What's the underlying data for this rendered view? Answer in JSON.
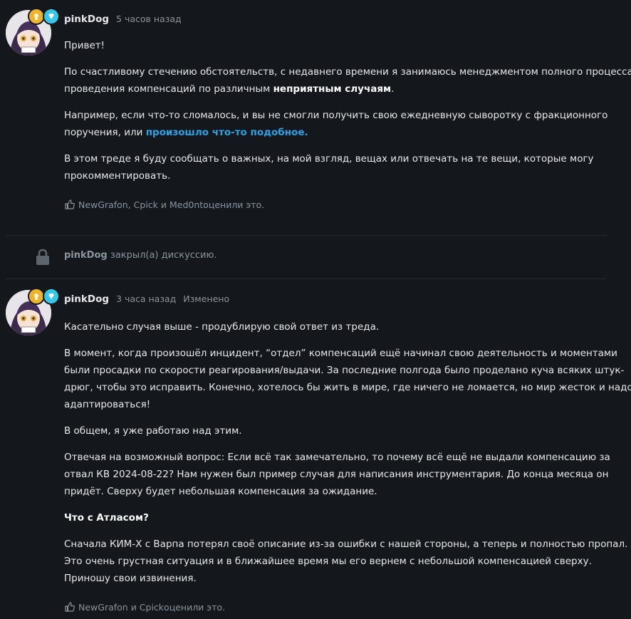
{
  "post1": {
    "author": "pinkDog",
    "time": "5 часов назад",
    "p1": "Привет!",
    "p2_a": "По счастливому стечению обстоятельств, с недавнего времени я занимаюсь менеджментом полного процесса проведения компенсаций по различным ",
    "p2_bold": "неприятным случаям",
    "p2_end": ".",
    "p3_a": "Например, если что-то сломалось, и вы не смогли получить свою ежедневную сыворотку с фракционного поручения, или ",
    "p3_link": "произошло что-то подобное",
    "p3_end": ".",
    "p4": "В этом треде я буду сообщать о важных, на мой взгляд, вещах или отвечать на те вещи, которые могу прокомментировать.",
    "likes_names": "NewGrafon, Cpick и Med0nt",
    "likes_suffix": " оценили это."
  },
  "event": {
    "author": "pinkDog",
    "text": " закрыл(а) дискуссию."
  },
  "post2": {
    "author": "pinkDog",
    "time": "3 часа назад",
    "edited": "Изменено",
    "p1": "Касательно случая выше - продублирую свой ответ из треда.",
    "p2": "В момент, когда произошёл инцидент, “отдел” компенсаций ещё начинал свою деятельность и моментами были просадки по скорости реагирования/выдачи. За последние полгода было проделано куча всяких штук-дрюг, чтобы это исправить. Конечно, хотелось бы жить в мире, где ничего не ломается, но мир жесток и надо адаптироваться!",
    "p3": "В общем, я уже работаю над этим.",
    "p4": "Отвечая на возможный вопрос: Если всё так замечательно, то почему всё ещё не выдали компенсацию за отвал КВ 2024-08-22? Нам нужен был пример случая для написания инструментария. До конца месяца он придёт. Сверху будет небольшая компенсация за ожидание.",
    "heading": "Что с Атласом?",
    "p5": "Сначала КИМ-Х с Варпа потерял своё описание из-за ошибки с нашей стороны, а теперь и полностью пропал. Это очень грустная ситуация и в ближайшее время мы его вернем с небольшой компенсацией сверху. Приношу свои извинения.",
    "likes_names": "NewGrafon и Cpick",
    "likes_suffix": " оценили это."
  },
  "colors": {
    "background": "#14181d",
    "text": "#e6e8ea",
    "muted": "#8a949c",
    "link": "#2aa4e6",
    "badge_gold": "#f0b42c",
    "badge_gem": "#36c7e6"
  },
  "icons": {
    "like": "thumbs-up-icon",
    "lock": "lock-icon",
    "badge1": "gold-badge-icon",
    "badge2": "diamond-badge-icon"
  }
}
